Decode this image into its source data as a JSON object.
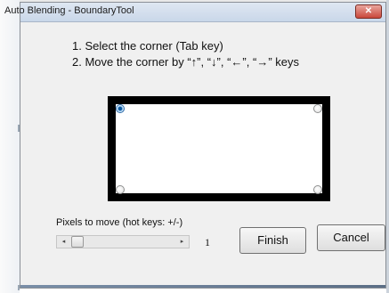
{
  "window": {
    "title": "Auto Blending - BoundaryTool",
    "close_glyph": "✕"
  },
  "instructions": {
    "line1": "1. Select the corner (Tab key)",
    "line2": "2. Move the corner by “↑”, “↓”, “←”, “→” keys"
  },
  "corners": {
    "selected": "top-left",
    "options": [
      "top-left",
      "top-right",
      "bottom-left",
      "bottom-right"
    ]
  },
  "slider": {
    "label": "Pixels to move (hot keys: +/-)",
    "value": "1",
    "left_arrow": "◂",
    "right_arrow": "▸"
  },
  "buttons": {
    "finish_label": "Finish",
    "cancel_label": "Cancel"
  },
  "colors": {
    "frame": "#000000",
    "selected_radio": "#0f5aa0"
  }
}
